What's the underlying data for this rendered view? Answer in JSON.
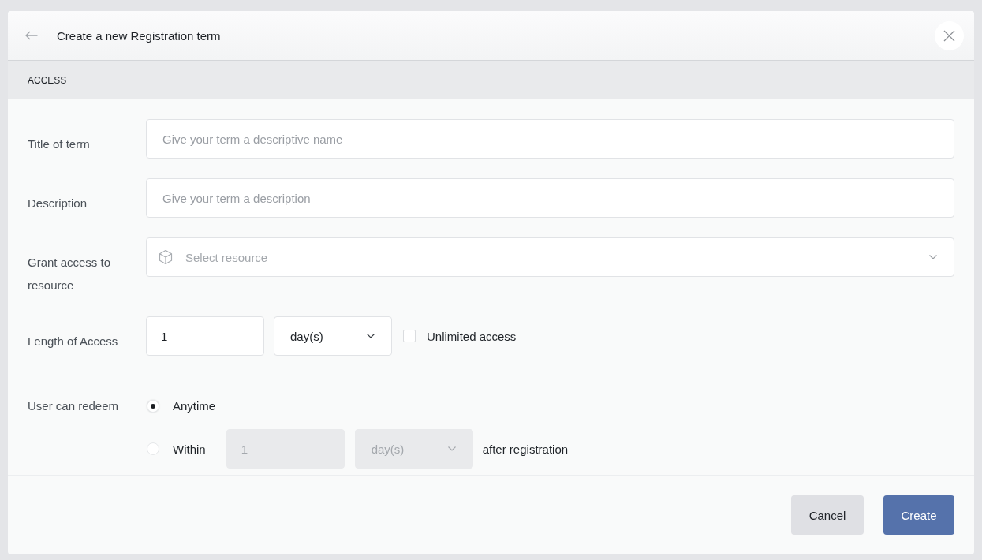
{
  "header": {
    "title": "Create a new Registration term"
  },
  "section": {
    "title": "ACCESS"
  },
  "fields": [
    {
      "kind": "text",
      "label": "Title of term",
      "placeholder": "Give your term a descriptive name"
    },
    {
      "kind": "text",
      "label": "Description",
      "placeholder": "Give your term a description"
    },
    {
      "kind": "select",
      "label": "Grant access to resource",
      "placeholder": "Select resource"
    },
    {
      "kind": "length",
      "label": "Length of Access",
      "value": "1",
      "unit": "day(s)",
      "checkbox": {
        "label": "Unlimited access",
        "checked": false
      }
    },
    {
      "kind": "radio",
      "label": "User can redeem",
      "options": [
        {
          "label": "Anytime",
          "selected": true
        },
        {
          "label": "Within",
          "selected": false,
          "disabled": true,
          "value": "1",
          "unit": "day(s)",
          "suffix": "after registration"
        }
      ]
    }
  ],
  "buttons": [
    {
      "kind": "secondary",
      "label": "Cancel"
    },
    {
      "kind": "primary",
      "label": "Create"
    }
  ]
}
